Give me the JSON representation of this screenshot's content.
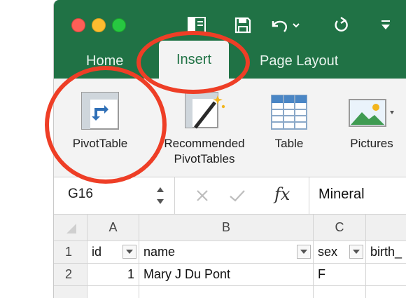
{
  "ribbon_tabs": {
    "home": "Home",
    "insert": "Insert",
    "page_layout": "Page Layout"
  },
  "ribbon_buttons": {
    "pivot_table": "PivotTable",
    "recommended_1": "Recommended",
    "recommended_2": "PivotTables",
    "table": "Table",
    "pictures": "Pictures"
  },
  "formula_bar": {
    "name_box": "G16",
    "fx": "fx",
    "content": "Mineral"
  },
  "sheet": {
    "columns": [
      "A",
      "B",
      "C"
    ],
    "header_row": {
      "num": "1",
      "a": "id",
      "b": "name",
      "c": "sex",
      "d": "birth_"
    },
    "row2": {
      "num": "2",
      "a": "1",
      "b": "Mary J Du Pont",
      "c": "F"
    }
  },
  "colors": {
    "excel_green": "#207245",
    "annotation_red": "#ee3e26"
  }
}
